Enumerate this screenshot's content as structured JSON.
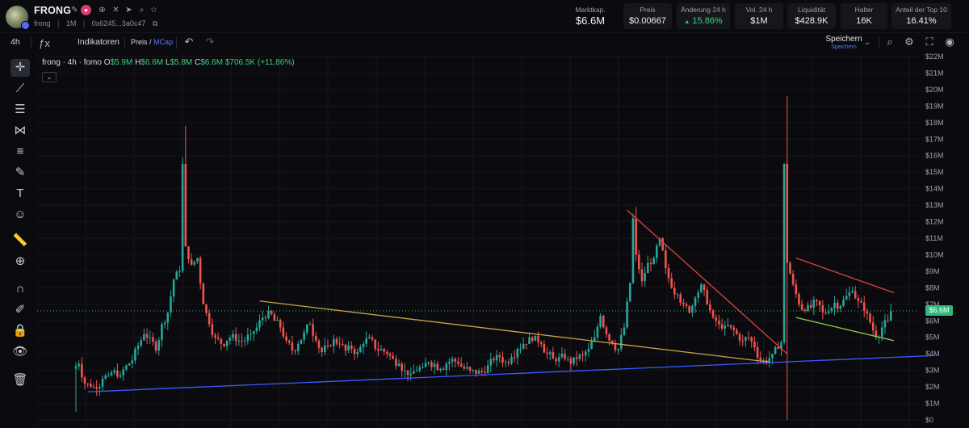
{
  "header": {
    "token_name": "FRONG",
    "symbol": "frong",
    "timeframe_tag": "1M",
    "address": "0x6245...3a0c47",
    "icons": [
      "edit-icon",
      "pump-icon",
      "globe-icon",
      "x-icon",
      "telegram-icon",
      "search-icon",
      "star-icon"
    ]
  },
  "stats": {
    "market_cap": {
      "label": "Marktkap.",
      "value": "$6.6M"
    },
    "price": {
      "label": "Preis",
      "value": "$0.00667"
    },
    "change_24h": {
      "label": "Änderung 24 h",
      "value": "15.86%",
      "arrow": "▲"
    },
    "volume_24h": {
      "label": "Vol. 24 h",
      "value": "$1M"
    },
    "liquidity": {
      "label": "Liquidität",
      "value": "$428.9K"
    },
    "holders": {
      "label": "Halter",
      "value": "16K"
    },
    "top10_share": {
      "label": "Anteil der Top 10",
      "value": "16.41%"
    }
  },
  "toolbar": {
    "interval": "4h",
    "indicators_label": "Indikatoren",
    "price_label": "Preis",
    "slash": "/",
    "mcap_label": "MCap",
    "save_label": "Speichern",
    "save_sub": "Speichern"
  },
  "legend": {
    "title": "frong · 4h · fomo",
    "open_key": "O",
    "open": "$5.9M",
    "high_key": "H",
    "high": "$6.6M",
    "low_key": "L",
    "low": "$5.8M",
    "close_key": "C",
    "close": "$6.6M",
    "change": "$706.5K (+11,86%)"
  },
  "colors": {
    "up": "#26a69a",
    "down": "#ef5350",
    "blue_trend": "#3d5afe",
    "yellow_trend": "#c9a24a",
    "red_trend": "#e0413e",
    "green_trend": "#8bc34a",
    "price_tag": "#2fb87a"
  },
  "chart_data": {
    "type": "candlestick",
    "y_axis_label_prefix": "$",
    "ylim": [
      0,
      22
    ],
    "y_unit": "M",
    "y_ticks": [
      "$22M",
      "$21M",
      "$20M",
      "$19M",
      "$18M",
      "$17M",
      "$16M",
      "$15M",
      "$14M",
      "$13M",
      "$12M",
      "$11M",
      "$10M",
      "$9M",
      "$8M",
      "$7M",
      "$6M",
      "$5M",
      "$4M",
      "$3M",
      "$2M",
      "$1M",
      "$0"
    ],
    "y_tick_values": [
      22,
      21,
      20,
      19,
      18,
      17,
      16,
      15,
      14,
      13,
      12,
      11,
      10,
      9,
      8,
      7,
      6,
      5,
      4,
      3,
      2,
      1,
      0
    ],
    "current_value": 6.6,
    "current_label": "$6.6M",
    "price_path": [
      [
        0,
        3.1
      ],
      [
        2,
        3.4
      ],
      [
        4,
        2.2
      ],
      [
        6,
        2.0
      ],
      [
        8,
        1.9
      ],
      [
        10,
        2.5
      ],
      [
        12,
        2.7
      ],
      [
        14,
        3.0
      ],
      [
        16,
        2.7
      ],
      [
        18,
        3.3
      ],
      [
        20,
        3.6
      ],
      [
        22,
        4.5
      ],
      [
        24,
        5.2
      ],
      [
        26,
        5.0
      ],
      [
        28,
        4.2
      ],
      [
        30,
        5.8
      ],
      [
        32,
        6.5
      ],
      [
        34,
        8.5
      ],
      [
        36,
        9.0
      ],
      [
        37,
        15.5
      ],
      [
        38,
        10.5
      ],
      [
        40,
        9.4
      ],
      [
        42,
        9.8
      ],
      [
        44,
        7.0
      ],
      [
        46,
        5.8
      ],
      [
        48,
        5.0
      ],
      [
        50,
        4.6
      ],
      [
        52,
        4.8
      ],
      [
        54,
        5.2
      ],
      [
        56,
        4.8
      ],
      [
        58,
        4.8
      ],
      [
        60,
        5.2
      ],
      [
        62,
        5.6
      ],
      [
        64,
        6.2
      ],
      [
        66,
        6.6
      ],
      [
        68,
        6.0
      ],
      [
        70,
        5.6
      ],
      [
        72,
        4.8
      ],
      [
        74,
        4.2
      ],
      [
        76,
        4.6
      ],
      [
        78,
        5.3
      ],
      [
        80,
        5.8
      ],
      [
        82,
        4.8
      ],
      [
        84,
        4.1
      ],
      [
        86,
        4.5
      ],
      [
        88,
        4.9
      ],
      [
        90,
        4.6
      ],
      [
        92,
        4.2
      ],
      [
        94,
        4.3
      ],
      [
        96,
        4.1
      ],
      [
        98,
        4.6
      ],
      [
        100,
        5.0
      ],
      [
        102,
        4.3
      ],
      [
        104,
        4.3
      ],
      [
        106,
        4.0
      ],
      [
        108,
        3.7
      ],
      [
        110,
        3.4
      ],
      [
        112,
        3.0
      ],
      [
        114,
        2.8
      ],
      [
        116,
        3.0
      ],
      [
        118,
        3.2
      ],
      [
        120,
        3.5
      ],
      [
        122,
        3.4
      ],
      [
        124,
        3.1
      ],
      [
        126,
        3.4
      ],
      [
        128,
        3.7
      ],
      [
        130,
        3.4
      ],
      [
        132,
        3.1
      ],
      [
        134,
        3.0
      ],
      [
        136,
        2.8
      ],
      [
        138,
        2.9
      ],
      [
        140,
        3.3
      ],
      [
        142,
        3.6
      ],
      [
        144,
        3.8
      ],
      [
        146,
        3.5
      ],
      [
        148,
        3.8
      ],
      [
        150,
        4.3
      ],
      [
        152,
        4.6
      ],
      [
        154,
        5.0
      ],
      [
        156,
        5.1
      ],
      [
        158,
        4.6
      ],
      [
        160,
        4.0
      ],
      [
        162,
        3.7
      ],
      [
        164,
        3.8
      ],
      [
        166,
        3.7
      ],
      [
        168,
        3.4
      ],
      [
        170,
        3.7
      ],
      [
        172,
        3.9
      ],
      [
        174,
        4.3
      ],
      [
        176,
        5.0
      ],
      [
        178,
        6.3
      ],
      [
        180,
        5.2
      ],
      [
        182,
        4.6
      ],
      [
        184,
        4.3
      ],
      [
        186,
        5.6
      ],
      [
        188,
        8.3
      ],
      [
        189,
        12.2
      ],
      [
        190,
        10.0
      ],
      [
        192,
        8.4
      ],
      [
        194,
        9.5
      ],
      [
        196,
        9.8
      ],
      [
        198,
        11.0
      ],
      [
        200,
        9.2
      ],
      [
        202,
        8.0
      ],
      [
        204,
        7.6
      ],
      [
        206,
        7.0
      ],
      [
        208,
        6.5
      ],
      [
        210,
        7.4
      ],
      [
        212,
        8.2
      ],
      [
        214,
        7.0
      ],
      [
        216,
        6.2
      ],
      [
        218,
        5.8
      ],
      [
        220,
        5.7
      ],
      [
        222,
        5.6
      ],
      [
        224,
        5.2
      ],
      [
        226,
        4.8
      ],
      [
        228,
        5.0
      ],
      [
        230,
        4.4
      ],
      [
        232,
        3.6
      ],
      [
        234,
        3.5
      ],
      [
        236,
        4.0
      ],
      [
        238,
        4.3
      ],
      [
        239,
        4.7
      ],
      [
        240,
        15.5
      ],
      [
        241,
        9.5
      ],
      [
        243,
        8.2
      ],
      [
        245,
        7.0
      ],
      [
        247,
        6.6
      ],
      [
        249,
        6.8
      ],
      [
        251,
        7.2
      ],
      [
        253,
        6.5
      ],
      [
        255,
        6.6
      ],
      [
        257,
        7.1
      ],
      [
        259,
        6.9
      ],
      [
        261,
        7.5
      ],
      [
        263,
        7.8
      ],
      [
        265,
        7.2
      ],
      [
        267,
        6.6
      ],
      [
        269,
        5.9
      ],
      [
        271,
        5.0
      ],
      [
        273,
        5.6
      ],
      [
        275,
        6.0
      ],
      [
        276,
        6.6
      ]
    ],
    "trendlines": [
      {
        "name": "blue-support",
        "color": "#3d5afe",
        "x0": 4,
        "y0": 1.7,
        "x1": 290,
        "y1": 3.9
      },
      {
        "name": "yellow-resistance",
        "color": "#c9a24a",
        "x0": 62,
        "y0": 7.2,
        "x1": 234,
        "y1": 3.5
      },
      {
        "name": "red-resistance-1",
        "color": "#e0413e",
        "x0": 186,
        "y0": 12.7,
        "x1": 240,
        "y1": 4.0
      },
      {
        "name": "red-resistance-2",
        "color": "#e0413e",
        "x0": 243,
        "y0": 9.8,
        "x1": 276,
        "y1": 7.7
      },
      {
        "name": "green-support",
        "color": "#8bc34a",
        "x0": 243,
        "y0": 6.2,
        "x1": 276,
        "y1": 4.8
      }
    ]
  }
}
